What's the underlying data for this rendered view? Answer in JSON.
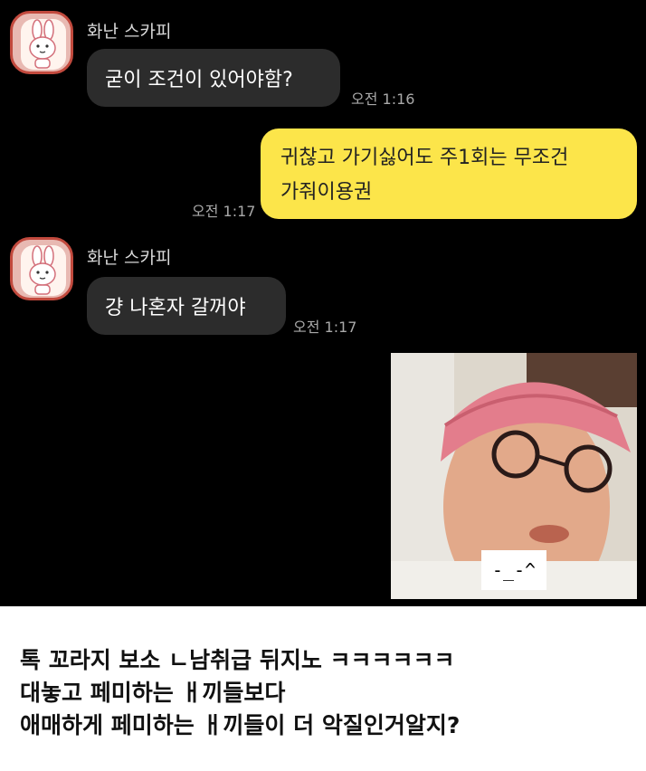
{
  "chat": {
    "messages": [
      {
        "sender": "화난 스카피",
        "text": "굳이 조건이 있어야함?",
        "time": "오전 1:16"
      },
      {
        "text_lines": [
          "귀찮고 가기싫어도 주1회는 무조건",
          "가줘이용권"
        ],
        "time": "오전 1:17"
      },
      {
        "sender": "화난 스카피",
        "text": "걍 나혼자 갈꺼야",
        "time": "오전 1:17"
      }
    ],
    "photo_caption": "-_-^"
  },
  "post": {
    "lines": [
      "톡 꼬라지 보소 ㄴ남취급 뒤지노 ㅋㅋㅋㅋㅋㅋ",
      "대놓고 페미하는 ㅐ끼들보다",
      "애매하게 페미하는 ㅐ끼들이 더 악질인거알지?"
    ]
  },
  "colors": {
    "background": "#000000",
    "incoming_bubble": "#2c2c2c",
    "outgoing_bubble": "#fce54a",
    "timestamp": "#a9a9a9"
  }
}
